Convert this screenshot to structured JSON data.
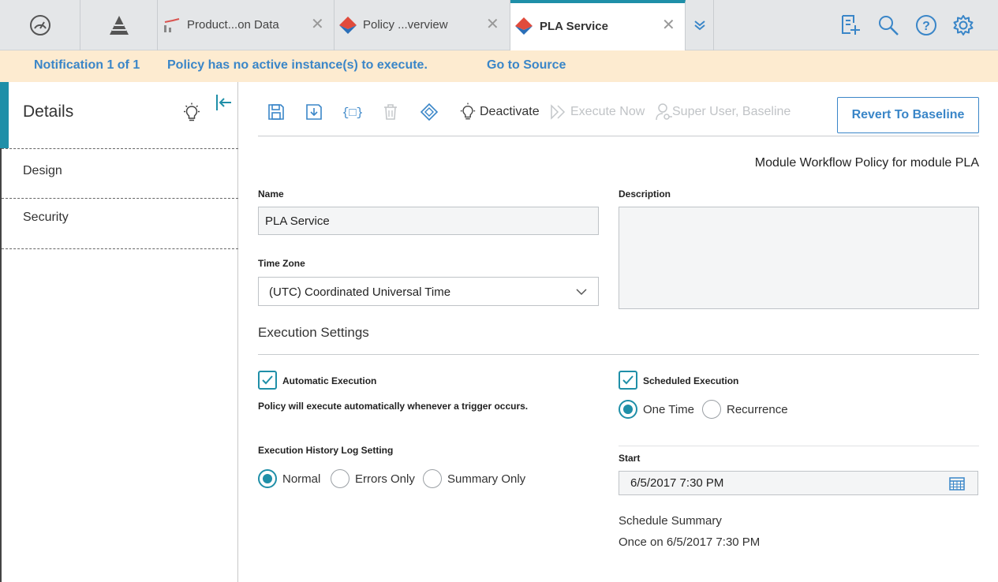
{
  "tabs": {
    "tab1": {
      "label": "Product...on Data"
    },
    "tab2": {
      "label": "Policy ...verview"
    },
    "tab3": {
      "label": "PLA Service"
    }
  },
  "notification": {
    "counter": "Notification 1 of 1",
    "message": "Policy has no active instance(s) to execute.",
    "link": "Go to Source"
  },
  "sidebar": {
    "title": "Details",
    "items": [
      {
        "label": "Design"
      },
      {
        "label": "Security"
      }
    ]
  },
  "toolbar": {
    "deactivate": "Deactivate",
    "execute_now": "Execute Now",
    "super_user": "Super User, Baseline",
    "revert": "Revert To Baseline"
  },
  "form": {
    "subtitle": "Module Workflow Policy for module PLA",
    "name_label": "Name",
    "name_value": "PLA Service",
    "description_label": "Description",
    "description_value": "",
    "timezone_label": "Time Zone",
    "timezone_value": "(UTC) Coordinated Universal Time",
    "execution_settings": "Execution Settings",
    "automatic_execution": "Automatic Execution",
    "automatic_note": "Policy will execute automatically whenever a trigger occurs.",
    "scheduled_execution": "Scheduled Execution",
    "one_time": "One Time",
    "recurrence": "Recurrence",
    "log_setting_label": "Execution History Log Setting",
    "log_normal": "Normal",
    "log_errors": "Errors Only",
    "log_summary": "Summary Only",
    "start_label": "Start",
    "start_value": "6/5/2017 7:30 PM",
    "schedule_summary_label": "Schedule Summary",
    "schedule_summary_value": "Once on 6/5/2017 7:30 PM"
  },
  "colors": {
    "accent": "#1f8fa8",
    "link": "#3a86c8",
    "notification_bg": "#fdebd0"
  }
}
